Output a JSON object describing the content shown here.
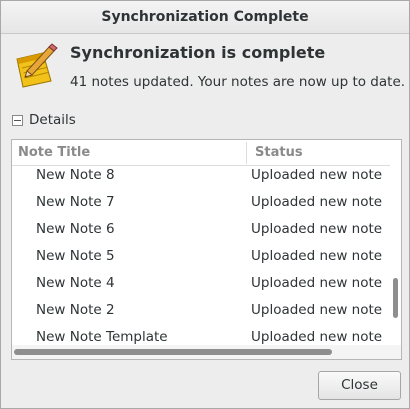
{
  "window": {
    "title": "Synchronization Complete"
  },
  "icon": "notepad-pencil-icon",
  "message": {
    "heading": "Synchronization is complete",
    "detail": "41 notes updated.  Your notes are now up to date."
  },
  "details": {
    "label": "Details",
    "expanded": true
  },
  "table": {
    "columns": [
      "Note Title",
      "Status"
    ],
    "rows": [
      {
        "title": "New Note 8",
        "status": "Uploaded new note to server"
      },
      {
        "title": "New Note 7",
        "status": "Uploaded new note to server"
      },
      {
        "title": "New Note 6",
        "status": "Uploaded new note to server"
      },
      {
        "title": "New Note 5",
        "status": "Uploaded new note to server"
      },
      {
        "title": "New Note 4",
        "status": "Uploaded new note to server"
      },
      {
        "title": "New Note 2",
        "status": "Uploaded new note to server"
      },
      {
        "title": "New Note Template",
        "status": "Uploaded new note to server"
      }
    ]
  },
  "buttons": {
    "close": "Close"
  }
}
